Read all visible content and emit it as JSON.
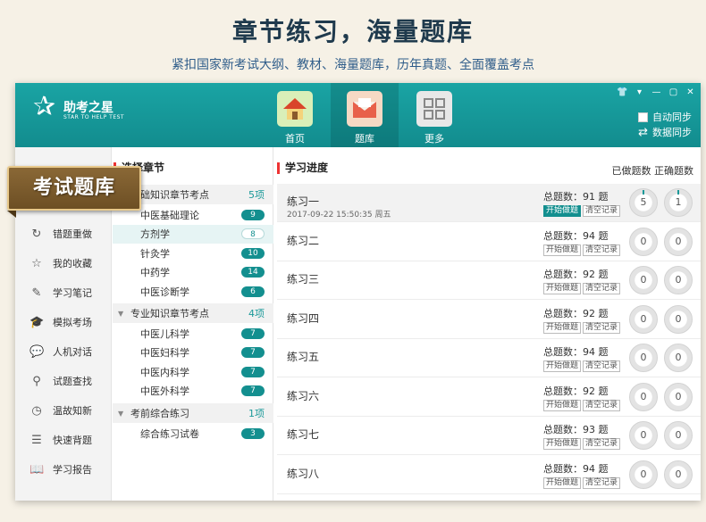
{
  "headline": {
    "title": "章节练习，海量题库",
    "subtitle": "紧扣国家新考试大纲、教材、海量题库，历年真题、全面覆盖考点"
  },
  "app": {
    "logo_name": "助考之星",
    "logo_sub": "STAR TO HELP TEST",
    "nav": [
      {
        "label": "首页",
        "icon": "house-icon",
        "active": false
      },
      {
        "label": "题库",
        "icon": "envelope-icon",
        "active": true
      },
      {
        "label": "更多",
        "icon": "grid-icon",
        "active": false
      }
    ],
    "auto_sync": "自动同步",
    "data_sync": "数据同步",
    "window_controls": [
      "shirt-icon",
      "menu-down-icon",
      "minimize-icon",
      "maximize-icon",
      "close-icon"
    ]
  },
  "ribbon": "考试题库",
  "sidebar": [
    {
      "label": "错题重做",
      "icon": "redo-icon"
    },
    {
      "label": "我的收藏",
      "icon": "star-icon"
    },
    {
      "label": "学习笔记",
      "icon": "pen-note-icon"
    },
    {
      "label": "模拟考场",
      "icon": "graduation-cap-icon"
    },
    {
      "label": "人机对话",
      "icon": "chat-bubble-icon"
    },
    {
      "label": "试题查找",
      "icon": "search-icon"
    },
    {
      "label": "温故知新",
      "icon": "clock-icon"
    },
    {
      "label": "快速背题",
      "icon": "book-list-icon"
    },
    {
      "label": "学习报告",
      "icon": "open-book-icon"
    }
  ],
  "chapters": {
    "title": "选择章节",
    "groups": [
      {
        "label": "基础知识章节考点",
        "count": "5项",
        "items": [
          {
            "label": "中医基础理论",
            "badge": "9",
            "selected": false
          },
          {
            "label": "方剂学",
            "badge": "8",
            "selected": true
          },
          {
            "label": "针灸学",
            "badge": "10",
            "selected": false
          },
          {
            "label": "中药学",
            "badge": "14",
            "selected": false
          },
          {
            "label": "中医诊断学",
            "badge": "6",
            "selected": false
          }
        ]
      },
      {
        "label": "专业知识章节考点",
        "count": "4项",
        "items": [
          {
            "label": "中医儿科学",
            "badge": "7",
            "selected": false
          },
          {
            "label": "中医妇科学",
            "badge": "7",
            "selected": false
          },
          {
            "label": "中医内科学",
            "badge": "7",
            "selected": false
          },
          {
            "label": "中医外科学",
            "badge": "7",
            "selected": false
          }
        ]
      },
      {
        "label": "考前综合练习",
        "count": "1项",
        "items": [
          {
            "label": "综合练习试卷",
            "badge": "3",
            "selected": false
          }
        ]
      }
    ]
  },
  "progress": {
    "title": "学习进度",
    "legend": "已做题数  正确题数",
    "start_label": "开始做题",
    "clear_label": "清空记录",
    "rows": [
      {
        "name": "练习一",
        "date": "2017-09-22 15:50:35 周五",
        "total": "总题数：91 题",
        "done": "5",
        "correct": "1"
      },
      {
        "name": "练习二",
        "date": "",
        "total": "总题数：94 题",
        "done": "0",
        "correct": "0"
      },
      {
        "name": "练习三",
        "date": "",
        "total": "总题数：92 题",
        "done": "0",
        "correct": "0"
      },
      {
        "name": "练习四",
        "date": "",
        "total": "总题数：92 题",
        "done": "0",
        "correct": "0"
      },
      {
        "name": "练习五",
        "date": "",
        "total": "总题数：94 题",
        "done": "0",
        "correct": "0"
      },
      {
        "name": "练习六",
        "date": "",
        "total": "总题数：92 题",
        "done": "0",
        "correct": "0"
      },
      {
        "name": "练习七",
        "date": "",
        "total": "总题数：93 题",
        "done": "0",
        "correct": "0"
      },
      {
        "name": "练习八",
        "date": "",
        "total": "总题数：94 题",
        "done": "0",
        "correct": "0"
      }
    ]
  },
  "colors": {
    "teal": "#128c8e",
    "accent_red": "#e33",
    "badge": "#138f8f",
    "ribbon": "#7a5a2a"
  }
}
